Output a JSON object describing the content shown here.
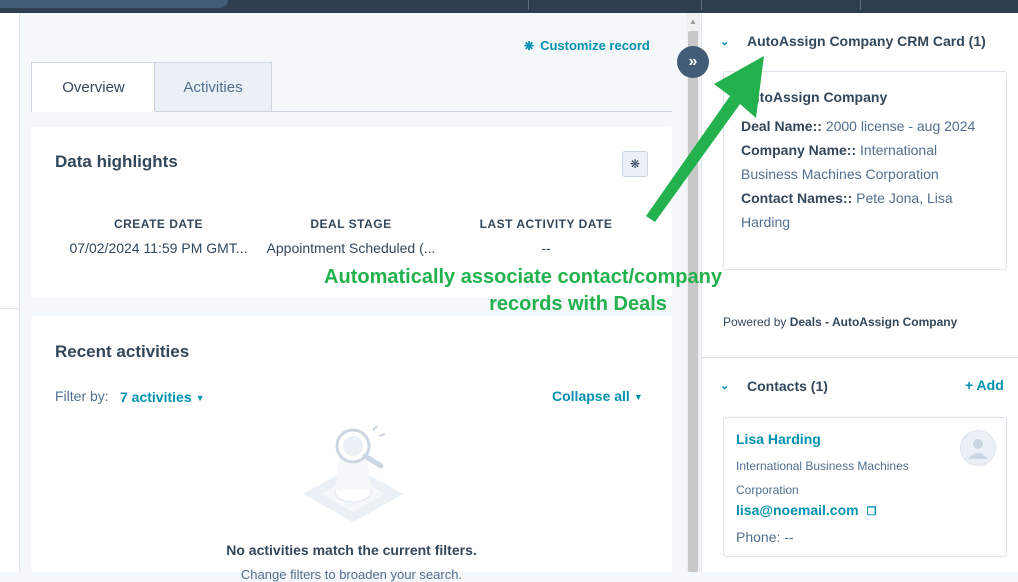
{
  "main": {
    "customize_label": "Customize record",
    "tabs": [
      {
        "label": "Overview",
        "active": true
      },
      {
        "label": "Activities",
        "active": false
      }
    ],
    "highlights": {
      "title": "Data highlights",
      "columns": [
        {
          "header": "CREATE DATE",
          "value": "07/02/2024 11:59 PM GMT..."
        },
        {
          "header": "DEAL STAGE",
          "value": "Appointment Scheduled (..."
        },
        {
          "header": "LAST ACTIVITY DATE",
          "value": "--"
        }
      ]
    },
    "recent": {
      "title": "Recent activities",
      "filter_label": "Filter by:",
      "filter_value": "7 activities",
      "collapse_label": "Collapse all",
      "empty_title": "No activities match the current filters.",
      "empty_sub": "Change filters to broaden your search."
    }
  },
  "annotation": {
    "line1": "Automatically associate contact/company",
    "line2": "records with Deals",
    "color": "#22b14c"
  },
  "sidebar": {
    "autoassign": {
      "title": "AutoAssign Company CRM Card (1)",
      "company": "AutoAssign Company",
      "deal_label": "Deal Name::",
      "deal_value": "2000 license - aug 2024",
      "company_label": "Company Name::",
      "company_value": "International Business Machines Corporation",
      "contact_label": "Contact Names::",
      "contact_value": "Pete Jona, Lisa Harding",
      "powered_prefix": "Powered by",
      "powered_name": "Deals - AutoAssign Company"
    },
    "contacts": {
      "title": "Contacts (1)",
      "add_label": "+ Add",
      "name": "Lisa Harding",
      "company": "International Business Machines Corporation",
      "email": "lisa@noemail.com",
      "phone": "Phone: --"
    }
  },
  "colors": {
    "link": "#0091ae",
    "text": "#33475b",
    "nav": "#2d3e50"
  },
  "icons": [
    "gear-icon",
    "expand-icon",
    "chevron-down-icon",
    "copy-icon",
    "avatar-icon",
    "magnifier-illustration"
  ]
}
